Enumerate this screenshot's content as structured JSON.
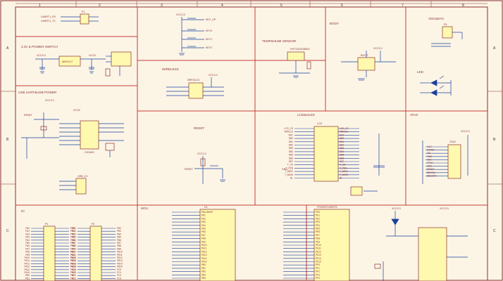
{
  "border": {
    "columns": [
      "1",
      "2",
      "3",
      "4",
      "5",
      "6",
      "7",
      "8"
    ],
    "rows": [
      "A",
      "B",
      "C"
    ]
  },
  "sections": {
    "uart_jumper": {
      "title": ""
    },
    "power_switch": {
      "title": "3.3V & POWER SWITCH"
    },
    "keys": {
      "title": ""
    },
    "temp_humi": {
      "title": "TEMP&HUMI SENSOR"
    },
    "boot": {
      "title": "BOOT"
    },
    "adc_dac": {
      "title": "ADC&DAC"
    },
    "wireless": {
      "title": "WIRELESS"
    },
    "led": {
      "title": "LED"
    },
    "usb_uart": {
      "title": "USB UART&USB POWER"
    },
    "reset": {
      "title": "RESET"
    },
    "lcd": {
      "title": "LCD&OLED"
    },
    "jtag": {
      "title": "JTAG"
    },
    "io": {
      "title": "IO"
    },
    "mcu": {
      "title": "MCU"
    }
  },
  "labels": {
    "usart1_tx": "USART1_RX",
    "usart1_rx": "USART1_TX",
    "u1_key1": "KEY_UP",
    "u1_key2": "KEY0",
    "u1_key3": "KEY1",
    "u1_key4": "KEY2",
    "vcc33": "VCC3.3",
    "vcc5": "VCC5",
    "gnd": "GND",
    "reset_net": "RESET",
    "ch340": "CH340G",
    "usb": "USB_2.0",
    "ams": "AMS1117",
    "lcd_ref": "LCD",
    "jtag_ref": "JTAG",
    "boot_ref": "BOOT",
    "dht": "DHT11/DS18B20",
    "nrf": "NRF24L01",
    "ldo": "LD0/OUT",
    "p1_ref": "P1",
    "p2_ref": "P2",
    "p4_ref": "P4",
    "u1_ref": "U1",
    "stm_ref": "STM32F103ZET6"
  },
  "mcu_left_pins": [
    "PA0-WKUP",
    "PA1",
    "PA2",
    "PA3",
    "PA4",
    "PA5",
    "PA6",
    "PA7",
    "PA8",
    "PA9",
    "PA10",
    "PA11",
    "PA12",
    "PA13",
    "PA14",
    "PA15",
    "PB0",
    "PB1",
    "PB2",
    "PB3",
    "PB4"
  ],
  "mcu_right_pins": [
    "PE0",
    "PE1",
    "PE2",
    "PE3",
    "PE4",
    "PE5",
    "PE6",
    "PE7",
    "PE8",
    "PE9",
    "PE10",
    "PE11",
    "PE12",
    "PE13",
    "PE14",
    "PE15",
    "PF0",
    "PF1",
    "PF2",
    "PF3",
    "PF4"
  ],
  "io_pins_a": [
    "PA0",
    "PA1",
    "PA2",
    "PA3",
    "PA4",
    "PA5",
    "PA6",
    "PA7",
    "PA8",
    "PA9",
    "PA10",
    "PA11",
    "PA12",
    "PA13",
    "PA14",
    "PA15",
    "PB0",
    "PB1"
  ],
  "io_pins_b": [
    "PB2",
    "PB3",
    "PB4",
    "PB5",
    "PB6",
    "PB7",
    "PB8",
    "PB9",
    "PB10",
    "PB11",
    "PB12",
    "PB13",
    "PB14",
    "PB15",
    "PC0",
    "PC1",
    "PC2",
    "PC3"
  ],
  "lcd_pins": [
    "LCD_CS",
    "WR/CLK",
    "RST",
    "DB0",
    "DB1",
    "DB2",
    "DB3",
    "DB4",
    "DB5",
    "DB6",
    "DB7",
    "T_CS",
    "T_PEN",
    "T_MISO",
    "T_MOSI",
    "BL"
  ],
  "jtag_pins": [
    "VCC",
    "NTRST",
    "TDI",
    "TMS",
    "TCK",
    "RTCK",
    "TDO",
    "RESET",
    "DBGRQ",
    "DBGACK"
  ]
}
